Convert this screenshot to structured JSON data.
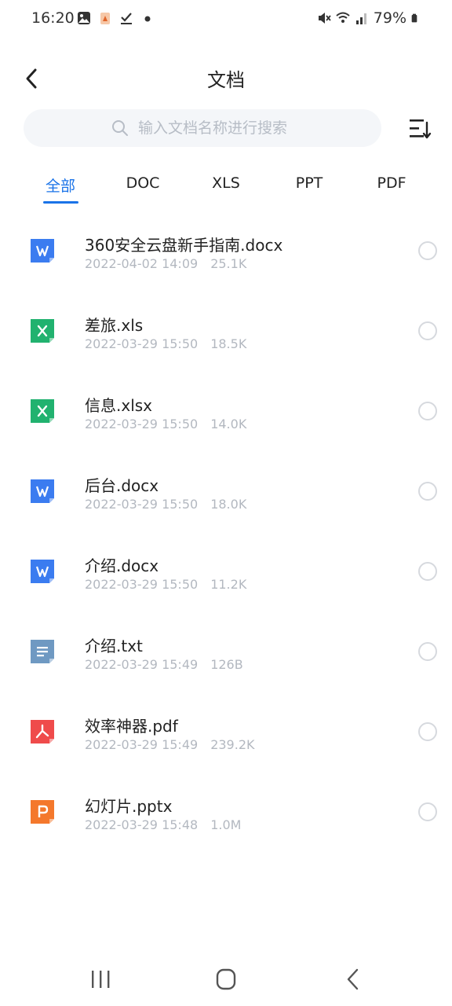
{
  "status_bar": {
    "time": "16:20",
    "battery": "79%",
    "left_icons": [
      "image-icon",
      "app-notification-icon",
      "checkmark-icon",
      "dot-icon"
    ],
    "right_icons": [
      "mute-icon",
      "wifi-icon",
      "signal-icon",
      "battery-icon"
    ]
  },
  "header": {
    "title": "文档"
  },
  "search": {
    "placeholder": "输入文档名称进行搜索"
  },
  "tabs": [
    {
      "label": "全部",
      "active": true
    },
    {
      "label": "DOC",
      "active": false
    },
    {
      "label": "XLS",
      "active": false
    },
    {
      "label": "PPT",
      "active": false
    },
    {
      "label": "PDF",
      "active": false
    }
  ],
  "files": [
    {
      "name": "360安全云盘新手指南.docx",
      "date": "2022-04-02 14:09",
      "size": "25.1K",
      "type": "doc",
      "color": "#3b7cf0"
    },
    {
      "name": "差旅.xls",
      "date": "2022-03-29 15:50",
      "size": "18.5K",
      "type": "xls",
      "color": "#21b26f"
    },
    {
      "name": "信息.xlsx",
      "date": "2022-03-29 15:50",
      "size": "14.0K",
      "type": "xls",
      "color": "#21b26f"
    },
    {
      "name": "后台.docx",
      "date": "2022-03-29 15:50",
      "size": "18.0K",
      "type": "doc",
      "color": "#3b7cf0"
    },
    {
      "name": "介绍.docx",
      "date": "2022-03-29 15:50",
      "size": "11.2K",
      "type": "doc",
      "color": "#3b7cf0"
    },
    {
      "name": "介绍.txt",
      "date": "2022-03-29 15:49",
      "size": "126B",
      "type": "txt",
      "color": "#6f99c2"
    },
    {
      "name": "效率神器.pdf",
      "date": "2022-03-29 15:49",
      "size": "239.2K",
      "type": "pdf",
      "color": "#ef4b4b"
    },
    {
      "name": "幻灯片.pptx",
      "date": "2022-03-29 15:48",
      "size": "1.0M",
      "type": "ppt",
      "color": "#f4782c"
    }
  ],
  "colors": {
    "accent": "#1a73e8",
    "meta_text": "#b3b8c0"
  }
}
